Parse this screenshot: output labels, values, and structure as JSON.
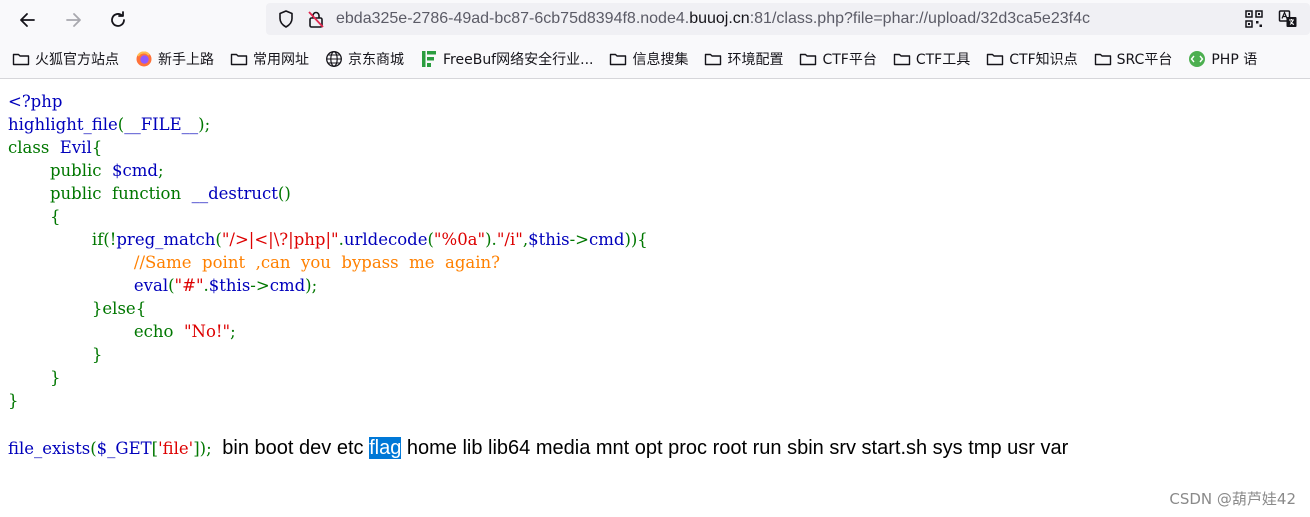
{
  "browser": {
    "url_prefix": "ebda325e-2786-49ad-bc87-6cb75d8394f8.node4.",
    "url_host": "buuoj.cn",
    "url_suffix": ":81/class.php?file=phar://upload/32d3ca5e23f4c",
    "bookmarks": [
      {
        "label": "火狐官方站点",
        "icon": "folder-icon"
      },
      {
        "label": "新手上路",
        "icon": "firefox-icon"
      },
      {
        "label": "常用网址",
        "icon": "folder-icon"
      },
      {
        "label": "京东商城",
        "icon": "globe-icon"
      },
      {
        "label": "FreeBuf网络安全行业...",
        "icon": "freebuf-icon"
      },
      {
        "label": "信息搜集",
        "icon": "folder-icon"
      },
      {
        "label": "环境配置",
        "icon": "folder-icon"
      },
      {
        "label": "CTF平台",
        "icon": "folder-icon"
      },
      {
        "label": "CTF工具",
        "icon": "folder-icon"
      },
      {
        "label": "CTF知识点",
        "icon": "folder-icon"
      },
      {
        "label": "SRC平台",
        "icon": "folder-icon"
      },
      {
        "label": "PHP 语",
        "icon": "php-icon"
      }
    ]
  },
  "code": {
    "l1": "<?php",
    "l2a": "highlight_file",
    "l2b": "(",
    "l2c": "__FILE__",
    "l2d": ");",
    "l3a": "class ",
    "l3b": "Evil",
    "l3c": "{",
    "l4a": "public ",
    "l4b": "$cmd",
    "l4c": ";",
    "l5a": "public ",
    "l5b": "function ",
    "l5c": "__destruct",
    "l5d": "()",
    "l6": "{",
    "l7a": "if(!",
    "l7b": "preg_match",
    "l7c": "(",
    "l7d": "\"/>|<|\\?|php|\"",
    "l7e": ".",
    "l7f": "urldecode",
    "l7g": "(",
    "l7h": "\"%0a\"",
    "l7i": ").",
    "l7j": "\"/i\"",
    "l7k": ",",
    "l7l": "$this",
    "l7m": "->",
    "l7n": "cmd",
    "l7o": ")){",
    "l8": "//Same  point  ,can  you  bypass  me  again?",
    "l9a": "eval",
    "l9b": "(",
    "l9c": "\"#\"",
    "l9d": ".",
    "l9e": "$this",
    "l9f": "->",
    "l9g": "cmd",
    "l9h": ");",
    "l10a": "}else{",
    "l11a": "echo ",
    "l11b": "\"No!\"",
    "l11c": ";",
    "l12": "}",
    "l13": "}",
    "l14": "}"
  },
  "bottom": {
    "c1": "file_exists",
    "c2": "(",
    "c3": "$_GET",
    "c4": "[",
    "c5": "'file'",
    "c6": "]);",
    "listing_before": "bin boot dev etc ",
    "listing_selected": "flag",
    "listing_after": " home lib lib64 media mnt opt proc root run sbin srv start.sh sys tmp usr var"
  },
  "watermark": "CSDN @葫芦娃42"
}
